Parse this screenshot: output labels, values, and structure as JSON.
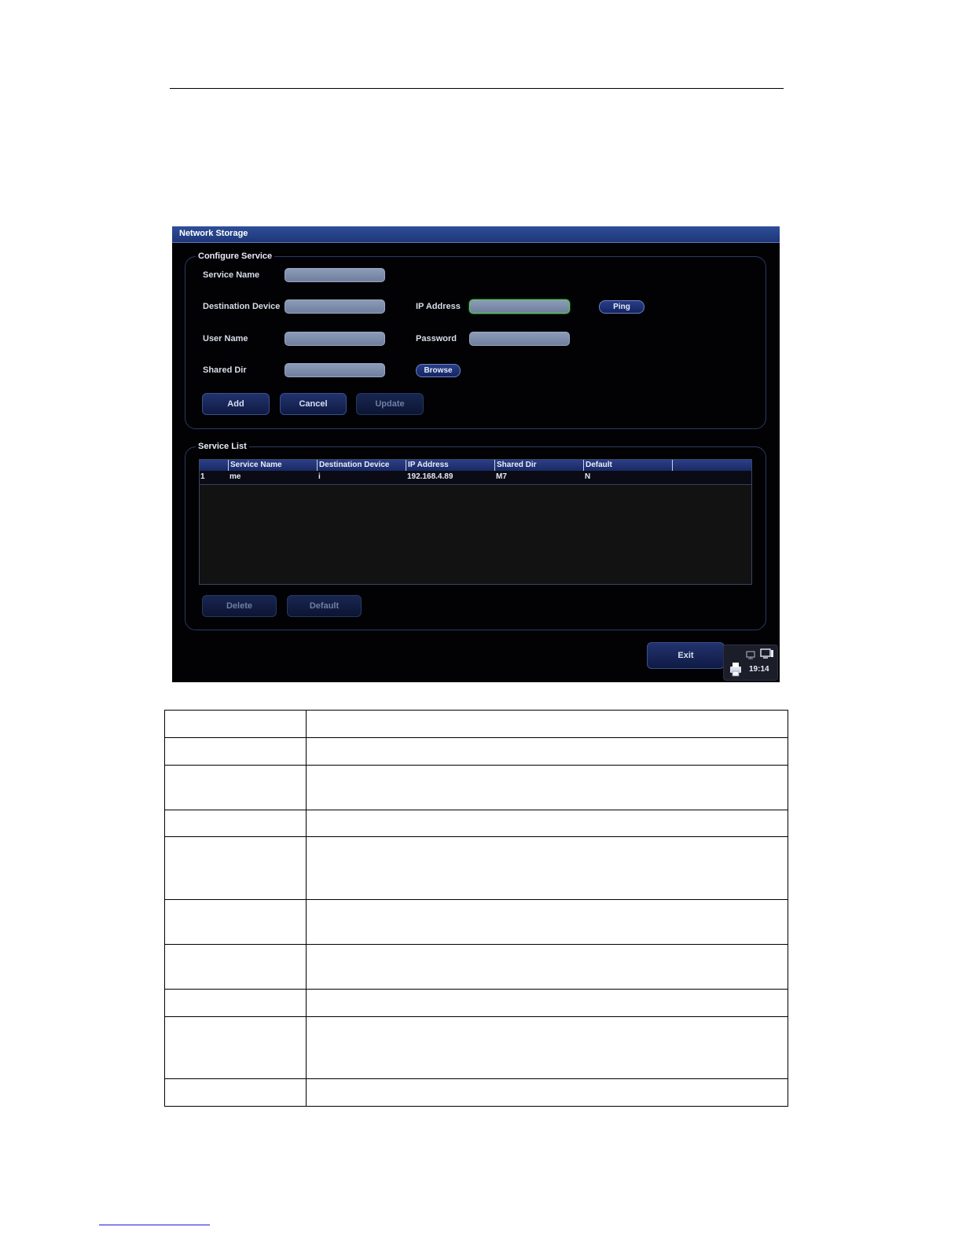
{
  "dialog": {
    "title": "Network Storage",
    "configure": {
      "group_label": "Configure Service",
      "service_name_label": "Service Name",
      "destination_device_label": "Destination Device",
      "ip_address_label": "IP Address",
      "user_name_label": "User Name",
      "password_label": "Password",
      "shared_dir_label": "Shared Dir",
      "ping_label": "Ping",
      "browse_label": "Browse",
      "add_label": "Add",
      "cancel_label": "Cancel",
      "update_label": "Update"
    },
    "service_list": {
      "group_label": "Service List",
      "columns": [
        "Service Name",
        "Destination Device",
        "IP Address",
        "Shared Dir",
        "Default"
      ],
      "rows": [
        {
          "index": "1",
          "service_name": "me",
          "destination_device": "i",
          "ip_address": "192.168.4.89",
          "shared_dir": "M7",
          "default": "N"
        }
      ],
      "delete_label": "Delete",
      "default_label": "Default"
    },
    "exit_label": "Exit",
    "tray": {
      "time": "19:14",
      "icons": [
        "network-icon",
        "monitor-icon",
        "printer-icon"
      ]
    }
  },
  "colors": {
    "title_bar": "#1d3677",
    "dialog_bg": "#020204",
    "focus_border": "#5fd35a"
  }
}
